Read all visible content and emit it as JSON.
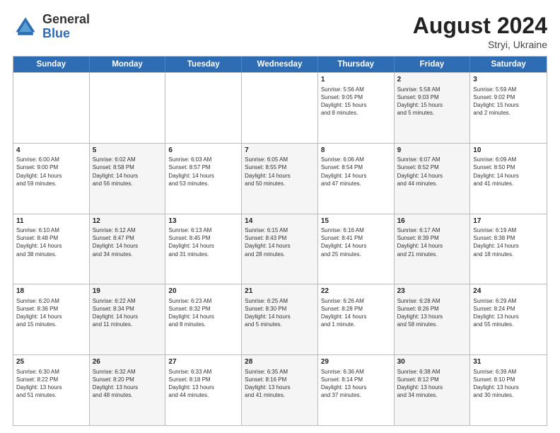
{
  "header": {
    "logo_general": "General",
    "logo_blue": "Blue",
    "month_year": "August 2024",
    "location": "Stryi, Ukraine"
  },
  "weekdays": [
    "Sunday",
    "Monday",
    "Tuesday",
    "Wednesday",
    "Thursday",
    "Friday",
    "Saturday"
  ],
  "rows": [
    [
      {
        "day": "",
        "info": "",
        "shaded": false
      },
      {
        "day": "",
        "info": "",
        "shaded": false
      },
      {
        "day": "",
        "info": "",
        "shaded": false
      },
      {
        "day": "",
        "info": "",
        "shaded": false
      },
      {
        "day": "1",
        "info": "Sunrise: 5:56 AM\nSunset: 9:05 PM\nDaylight: 15 hours\nand 8 minutes.",
        "shaded": false
      },
      {
        "day": "2",
        "info": "Sunrise: 5:58 AM\nSunset: 9:03 PM\nDaylight: 15 hours\nand 5 minutes.",
        "shaded": true
      },
      {
        "day": "3",
        "info": "Sunrise: 5:59 AM\nSunset: 9:02 PM\nDaylight: 15 hours\nand 2 minutes.",
        "shaded": false
      }
    ],
    [
      {
        "day": "4",
        "info": "Sunrise: 6:00 AM\nSunset: 9:00 PM\nDaylight: 14 hours\nand 59 minutes.",
        "shaded": false
      },
      {
        "day": "5",
        "info": "Sunrise: 6:02 AM\nSunset: 8:58 PM\nDaylight: 14 hours\nand 56 minutes.",
        "shaded": true
      },
      {
        "day": "6",
        "info": "Sunrise: 6:03 AM\nSunset: 8:57 PM\nDaylight: 14 hours\nand 53 minutes.",
        "shaded": false
      },
      {
        "day": "7",
        "info": "Sunrise: 6:05 AM\nSunset: 8:55 PM\nDaylight: 14 hours\nand 50 minutes.",
        "shaded": true
      },
      {
        "day": "8",
        "info": "Sunrise: 6:06 AM\nSunset: 8:54 PM\nDaylight: 14 hours\nand 47 minutes.",
        "shaded": false
      },
      {
        "day": "9",
        "info": "Sunrise: 6:07 AM\nSunset: 8:52 PM\nDaylight: 14 hours\nand 44 minutes.",
        "shaded": true
      },
      {
        "day": "10",
        "info": "Sunrise: 6:09 AM\nSunset: 8:50 PM\nDaylight: 14 hours\nand 41 minutes.",
        "shaded": false
      }
    ],
    [
      {
        "day": "11",
        "info": "Sunrise: 6:10 AM\nSunset: 8:48 PM\nDaylight: 14 hours\nand 38 minutes.",
        "shaded": false
      },
      {
        "day": "12",
        "info": "Sunrise: 6:12 AM\nSunset: 8:47 PM\nDaylight: 14 hours\nand 34 minutes.",
        "shaded": true
      },
      {
        "day": "13",
        "info": "Sunrise: 6:13 AM\nSunset: 8:45 PM\nDaylight: 14 hours\nand 31 minutes.",
        "shaded": false
      },
      {
        "day": "14",
        "info": "Sunrise: 6:15 AM\nSunset: 8:43 PM\nDaylight: 14 hours\nand 28 minutes.",
        "shaded": true
      },
      {
        "day": "15",
        "info": "Sunrise: 6:16 AM\nSunset: 8:41 PM\nDaylight: 14 hours\nand 25 minutes.",
        "shaded": false
      },
      {
        "day": "16",
        "info": "Sunrise: 6:17 AM\nSunset: 8:39 PM\nDaylight: 14 hours\nand 21 minutes.",
        "shaded": true
      },
      {
        "day": "17",
        "info": "Sunrise: 6:19 AM\nSunset: 8:38 PM\nDaylight: 14 hours\nand 18 minutes.",
        "shaded": false
      }
    ],
    [
      {
        "day": "18",
        "info": "Sunrise: 6:20 AM\nSunset: 8:36 PM\nDaylight: 14 hours\nand 15 minutes.",
        "shaded": false
      },
      {
        "day": "19",
        "info": "Sunrise: 6:22 AM\nSunset: 8:34 PM\nDaylight: 14 hours\nand 11 minutes.",
        "shaded": true
      },
      {
        "day": "20",
        "info": "Sunrise: 6:23 AM\nSunset: 8:32 PM\nDaylight: 14 hours\nand 8 minutes.",
        "shaded": false
      },
      {
        "day": "21",
        "info": "Sunrise: 6:25 AM\nSunset: 8:30 PM\nDaylight: 14 hours\nand 5 minutes.",
        "shaded": true
      },
      {
        "day": "22",
        "info": "Sunrise: 6:26 AM\nSunset: 8:28 PM\nDaylight: 14 hours\nand 1 minute.",
        "shaded": false
      },
      {
        "day": "23",
        "info": "Sunrise: 6:28 AM\nSunset: 8:26 PM\nDaylight: 13 hours\nand 58 minutes.",
        "shaded": true
      },
      {
        "day": "24",
        "info": "Sunrise: 6:29 AM\nSunset: 8:24 PM\nDaylight: 13 hours\nand 55 minutes.",
        "shaded": false
      }
    ],
    [
      {
        "day": "25",
        "info": "Sunrise: 6:30 AM\nSunset: 8:22 PM\nDaylight: 13 hours\nand 51 minutes.",
        "shaded": false
      },
      {
        "day": "26",
        "info": "Sunrise: 6:32 AM\nSunset: 8:20 PM\nDaylight: 13 hours\nand 48 minutes.",
        "shaded": true
      },
      {
        "day": "27",
        "info": "Sunrise: 6:33 AM\nSunset: 8:18 PM\nDaylight: 13 hours\nand 44 minutes.",
        "shaded": false
      },
      {
        "day": "28",
        "info": "Sunrise: 6:35 AM\nSunset: 8:16 PM\nDaylight: 13 hours\nand 41 minutes.",
        "shaded": true
      },
      {
        "day": "29",
        "info": "Sunrise: 6:36 AM\nSunset: 8:14 PM\nDaylight: 13 hours\nand 37 minutes.",
        "shaded": false
      },
      {
        "day": "30",
        "info": "Sunrise: 6:38 AM\nSunset: 8:12 PM\nDaylight: 13 hours\nand 34 minutes.",
        "shaded": true
      },
      {
        "day": "31",
        "info": "Sunrise: 6:39 AM\nSunset: 8:10 PM\nDaylight: 13 hours\nand 30 minutes.",
        "shaded": false
      }
    ]
  ]
}
